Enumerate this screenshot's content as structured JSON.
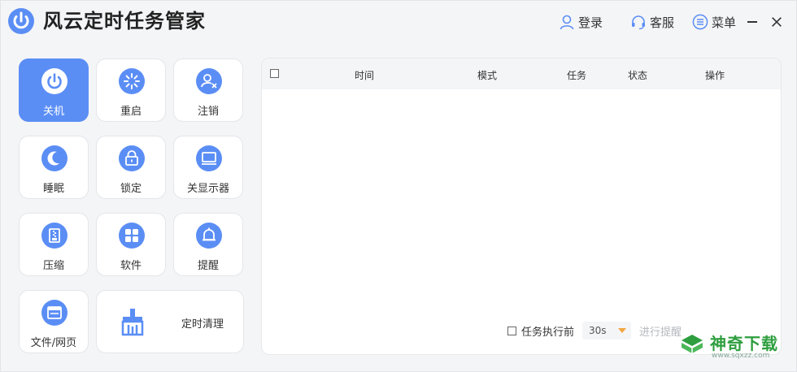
{
  "header": {
    "title": "风云定时任务管家",
    "login": "登录",
    "service": "客服",
    "menu": "菜单",
    "accent": "#5b8ef5"
  },
  "tiles": [
    {
      "label": "关机",
      "icon": "power-icon",
      "active": true
    },
    {
      "label": "重启",
      "icon": "restart-icon"
    },
    {
      "label": "注销",
      "icon": "logout-user-icon"
    },
    {
      "label": "睡眠",
      "icon": "moon-icon"
    },
    {
      "label": "锁定",
      "icon": "lock-icon"
    },
    {
      "label": "关显示器",
      "icon": "monitor-icon"
    },
    {
      "label": "压缩",
      "icon": "archive-icon"
    },
    {
      "label": "软件",
      "icon": "apps-icon"
    },
    {
      "label": "提醒",
      "icon": "bell-icon"
    },
    {
      "label": "文件/网页",
      "icon": "browser-icon"
    },
    {
      "label": "定时清理",
      "icon": "broom-icon"
    }
  ],
  "table": {
    "columns": [
      "时间",
      "模式",
      "任务",
      "状态",
      "操作"
    ],
    "rows": []
  },
  "footer": {
    "checkbox_label": "任务执行前",
    "delay_value": "30s",
    "remind_label": "进行提醒"
  },
  "watermark": {
    "text": "神奇下载",
    "url": "www.sqxzz.com"
  }
}
